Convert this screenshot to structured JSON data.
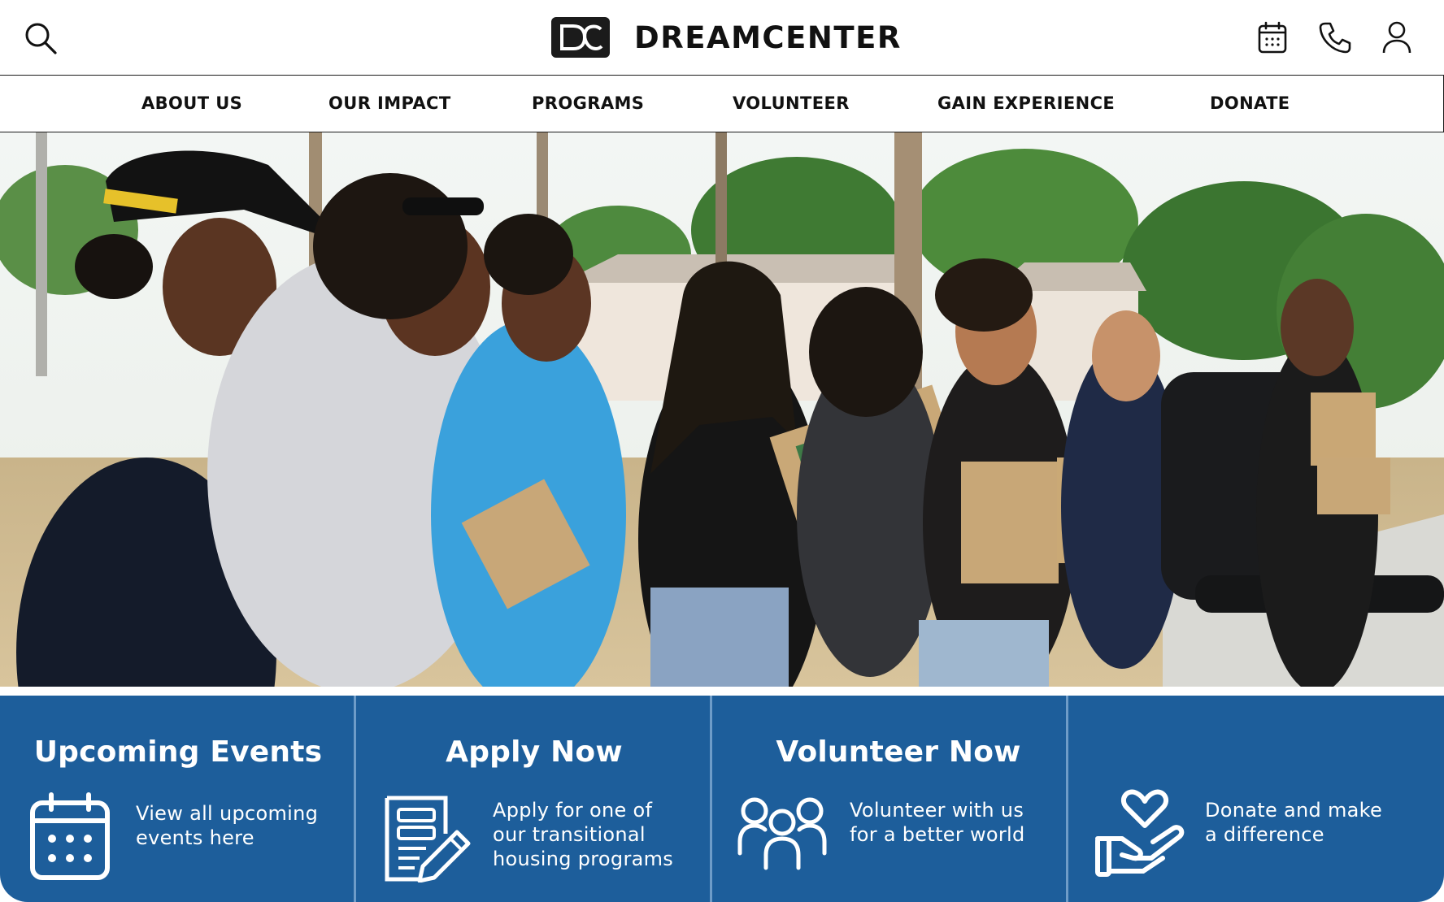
{
  "header": {
    "brand_name": "DREAMCENTER",
    "logo_letters": "DC",
    "search_icon": "search-icon",
    "calendar_icon": "calendar-icon",
    "phone_icon": "phone-icon",
    "account_icon": "user-icon"
  },
  "nav": {
    "items": [
      {
        "label": "ABOUT US"
      },
      {
        "label": "OUR IMPACT"
      },
      {
        "label": "PROGRAMS"
      },
      {
        "label": "VOLUNTEER"
      },
      {
        "label": "GAIN EXPERIENCE"
      },
      {
        "label": "DONATE"
      }
    ]
  },
  "cards": [
    {
      "title": "Upcoming Events",
      "icon": "calendar-icon",
      "lines": [
        "View all upcoming",
        "events here"
      ]
    },
    {
      "title": "Apply Now",
      "icon": "application-form-icon",
      "lines": [
        "Apply for one of",
        "our transitional",
        "housing programs"
      ]
    },
    {
      "title": "Volunteer Now",
      "icon": "people-group-icon",
      "lines": [
        "Volunteer with us",
        "for a better world"
      ]
    },
    {
      "title": "",
      "icon": "heart-in-hand-icon",
      "lines": [
        "Donate and make",
        "a difference"
      ]
    }
  ],
  "colors": {
    "accent_blue": "#1d5e9b",
    "text_dark": "#111111",
    "white": "#ffffff"
  }
}
